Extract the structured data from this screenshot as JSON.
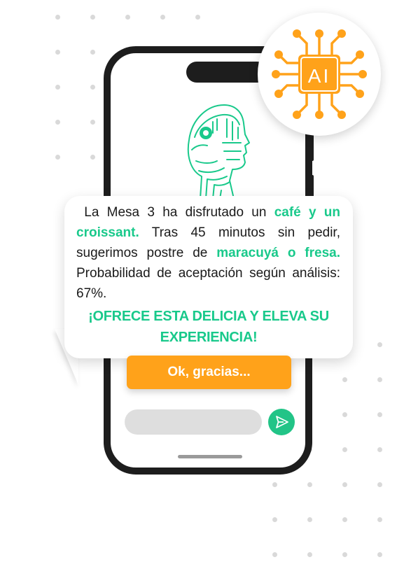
{
  "badge": {
    "text": "AI",
    "icon": "ai-chip-icon",
    "color": "#ffa21a"
  },
  "robot": {
    "icon": "robot-head-icon",
    "color": "#19c98b"
  },
  "message": {
    "p1": "La Mesa 3 ha disfrutado un ",
    "h1": "café  y un croissant.",
    "p2": " Tras 45 minutos sin pedir, sugerimos postre de ",
    "h2": "maracuyá o fresa.",
    "p3": " Probabilidad de aceptación según análisis: 67%.",
    "cta": "¡OFRECE ESTA DELICIA Y ELEVA SU EXPERIENCIA!"
  },
  "actions": {
    "ok_label": "Ok, gracias..."
  },
  "input": {
    "value": "",
    "placeholder": ""
  },
  "colors": {
    "accent_green": "#19c98b",
    "accent_orange": "#ffa21a",
    "send": "#22c487"
  }
}
